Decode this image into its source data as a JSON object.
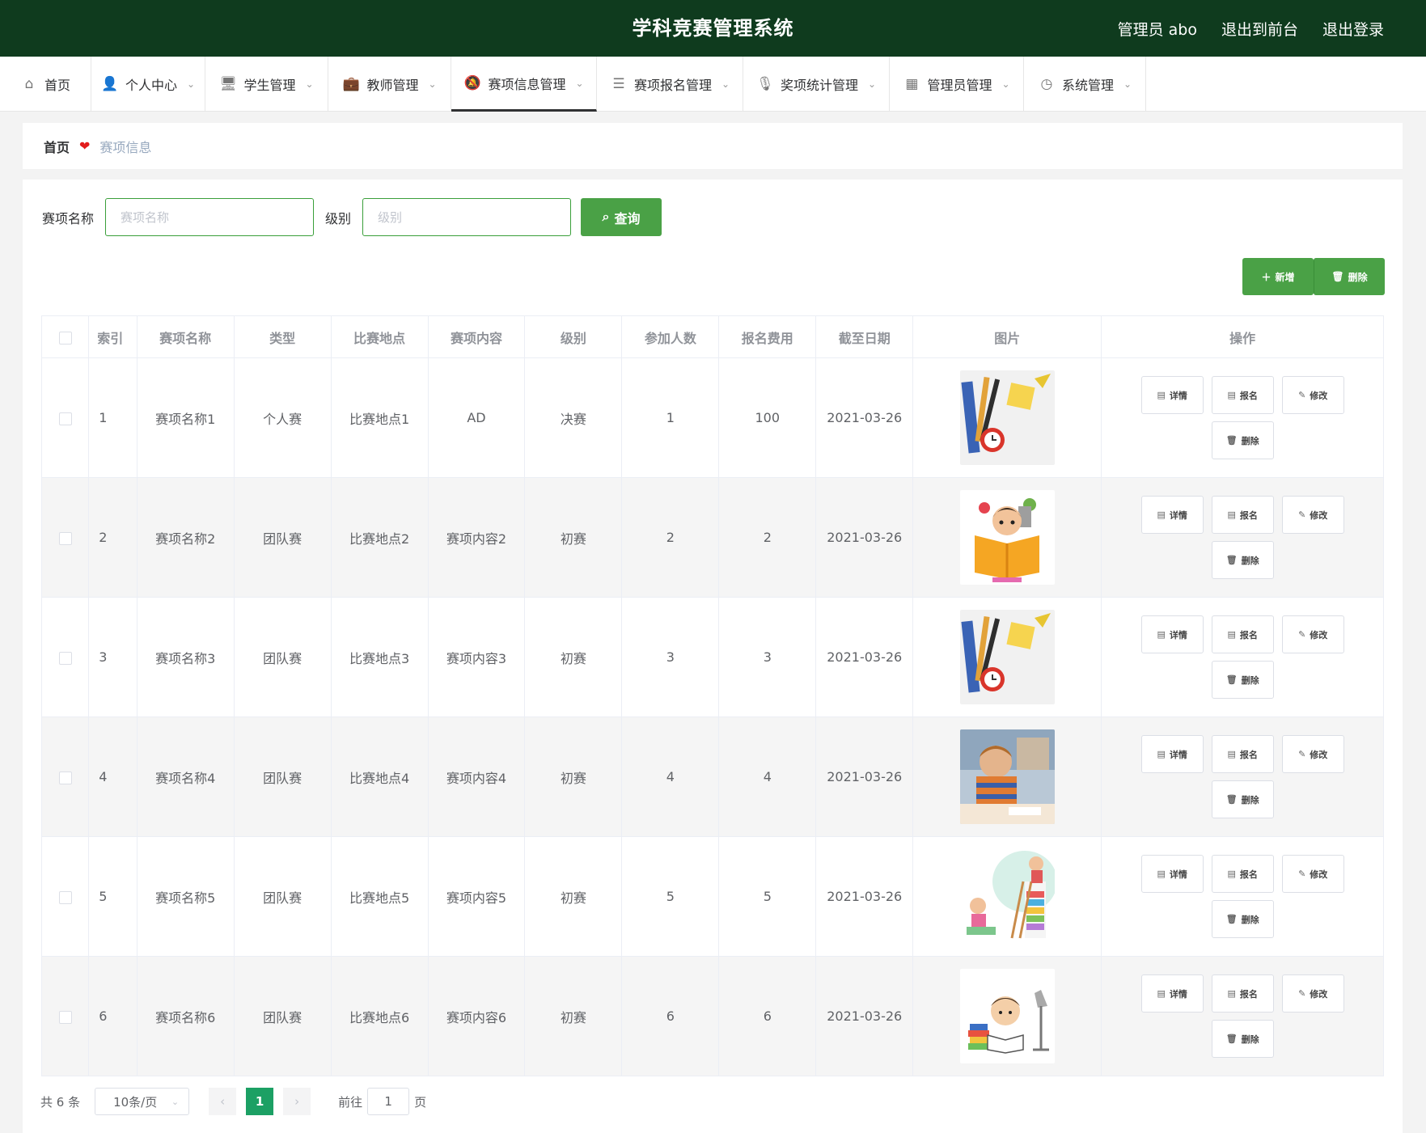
{
  "header": {
    "title": "学科竞赛管理系统",
    "user": "管理员 abo",
    "to_front": "退出到前台",
    "logout": "退出登录",
    "bg_color": "#0f3b1e"
  },
  "nav": [
    {
      "label": "首页",
      "icon": "home-icon",
      "glyph": "⌂",
      "caret": false
    },
    {
      "label": "个人中心",
      "icon": "user-icon",
      "glyph": "👤",
      "caret": true
    },
    {
      "label": "学生管理",
      "icon": "monitor-icon",
      "glyph": "🖥",
      "caret": true
    },
    {
      "label": "教师管理",
      "icon": "briefcase-icon",
      "glyph": "💼",
      "caret": true
    },
    {
      "label": "赛项信息管理",
      "icon": "bell-off-icon",
      "glyph": "🔕",
      "caret": true,
      "active": true
    },
    {
      "label": "赛项报名管理",
      "icon": "list-icon",
      "glyph": "☰",
      "caret": true
    },
    {
      "label": "奖项统计管理",
      "icon": "microphone-icon",
      "glyph": "🎙",
      "caret": true
    },
    {
      "label": "管理员管理",
      "icon": "grid-icon",
      "glyph": "▦",
      "caret": true
    },
    {
      "label": "系统管理",
      "icon": "compass-icon",
      "glyph": "◷",
      "caret": true
    }
  ],
  "breadcrumb": {
    "home": "首页",
    "current": "赛项信息"
  },
  "search": {
    "name_label": "赛项名称",
    "name_placeholder": "赛项名称",
    "level_label": "级别",
    "level_placeholder": "级别",
    "query_label": "查询"
  },
  "toolbar": {
    "add_label": "新增",
    "delete_label": "删除"
  },
  "table": {
    "headers": [
      "索引",
      "赛项名称",
      "类型",
      "比赛地点",
      "赛项内容",
      "级别",
      "参加人数",
      "报名费用",
      "截至日期",
      "图片",
      "操作"
    ],
    "op_labels": {
      "detail": "详情",
      "signup": "报名",
      "edit": "修改",
      "delete": "删除"
    },
    "rows": [
      {
        "index": "1",
        "name": "赛项名称1",
        "type": "个人赛",
        "location": "比赛地点1",
        "content": "AD",
        "level": "决赛",
        "participants": "1",
        "fee": "100",
        "deadline": "2021-03-26",
        "image": "stationery-pencils-clock"
      },
      {
        "index": "2",
        "name": "赛项名称2",
        "type": "团队赛",
        "location": "比赛地点2",
        "content": "赛项内容2",
        "level": "初赛",
        "participants": "2",
        "fee": "2",
        "deadline": "2021-03-26",
        "image": "child-reading-book"
      },
      {
        "index": "3",
        "name": "赛项名称3",
        "type": "团队赛",
        "location": "比赛地点3",
        "content": "赛项内容3",
        "level": "初赛",
        "participants": "3",
        "fee": "3",
        "deadline": "2021-03-26",
        "image": "stationery-pencils-clock"
      },
      {
        "index": "4",
        "name": "赛项名称4",
        "type": "团队赛",
        "location": "比赛地点4",
        "content": "赛项内容4",
        "level": "初赛",
        "participants": "4",
        "fee": "4",
        "deadline": "2021-03-26",
        "image": "boy-at-desk-photo"
      },
      {
        "index": "5",
        "name": "赛项名称5",
        "type": "团队赛",
        "location": "比赛地点5",
        "content": "赛项内容5",
        "level": "初赛",
        "participants": "5",
        "fee": "5",
        "deadline": "2021-03-26",
        "image": "kids-books-ladder"
      },
      {
        "index": "6",
        "name": "赛项名称6",
        "type": "团队赛",
        "location": "比赛地点6",
        "content": "赛项内容6",
        "level": "初赛",
        "participants": "6",
        "fee": "6",
        "deadline": "2021-03-26",
        "image": "child-studying-lamp"
      }
    ]
  },
  "pagination": {
    "total": "共 6 条",
    "page_size": "10条/页",
    "current_page": "1",
    "goto_label": "前往",
    "goto_value": "1",
    "page_unit": "页"
  },
  "colors": {
    "accent": "#4aa146",
    "page_active": "#1ca064",
    "heart": "#e21c1c"
  }
}
